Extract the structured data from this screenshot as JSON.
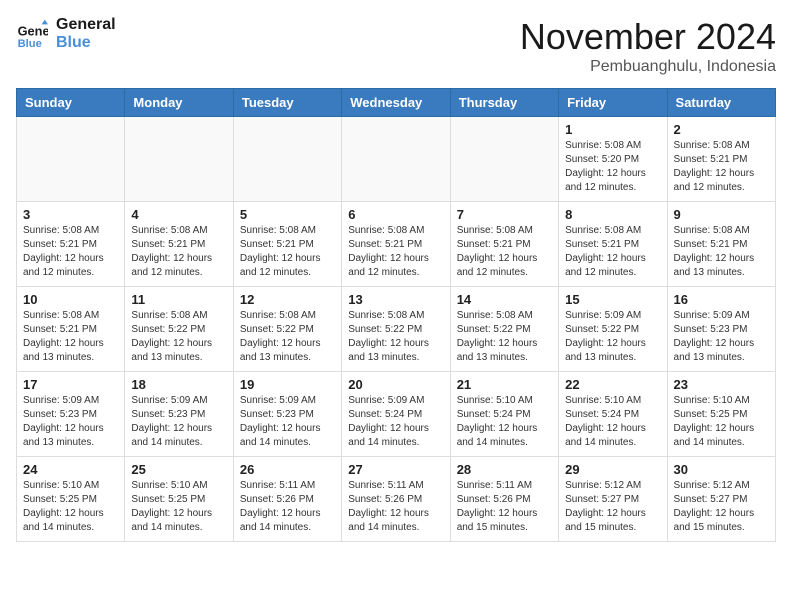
{
  "header": {
    "logo_line1": "General",
    "logo_line2": "Blue",
    "month": "November 2024",
    "location": "Pembuanghulu, Indonesia"
  },
  "days_of_week": [
    "Sunday",
    "Monday",
    "Tuesday",
    "Wednesday",
    "Thursday",
    "Friday",
    "Saturday"
  ],
  "weeks": [
    [
      {
        "day": "",
        "info": ""
      },
      {
        "day": "",
        "info": ""
      },
      {
        "day": "",
        "info": ""
      },
      {
        "day": "",
        "info": ""
      },
      {
        "day": "",
        "info": ""
      },
      {
        "day": "1",
        "info": "Sunrise: 5:08 AM\nSunset: 5:20 PM\nDaylight: 12 hours\nand 12 minutes."
      },
      {
        "day": "2",
        "info": "Sunrise: 5:08 AM\nSunset: 5:21 PM\nDaylight: 12 hours\nand 12 minutes."
      }
    ],
    [
      {
        "day": "3",
        "info": "Sunrise: 5:08 AM\nSunset: 5:21 PM\nDaylight: 12 hours\nand 12 minutes."
      },
      {
        "day": "4",
        "info": "Sunrise: 5:08 AM\nSunset: 5:21 PM\nDaylight: 12 hours\nand 12 minutes."
      },
      {
        "day": "5",
        "info": "Sunrise: 5:08 AM\nSunset: 5:21 PM\nDaylight: 12 hours\nand 12 minutes."
      },
      {
        "day": "6",
        "info": "Sunrise: 5:08 AM\nSunset: 5:21 PM\nDaylight: 12 hours\nand 12 minutes."
      },
      {
        "day": "7",
        "info": "Sunrise: 5:08 AM\nSunset: 5:21 PM\nDaylight: 12 hours\nand 12 minutes."
      },
      {
        "day": "8",
        "info": "Sunrise: 5:08 AM\nSunset: 5:21 PM\nDaylight: 12 hours\nand 12 minutes."
      },
      {
        "day": "9",
        "info": "Sunrise: 5:08 AM\nSunset: 5:21 PM\nDaylight: 12 hours\nand 13 minutes."
      }
    ],
    [
      {
        "day": "10",
        "info": "Sunrise: 5:08 AM\nSunset: 5:21 PM\nDaylight: 12 hours\nand 13 minutes."
      },
      {
        "day": "11",
        "info": "Sunrise: 5:08 AM\nSunset: 5:22 PM\nDaylight: 12 hours\nand 13 minutes."
      },
      {
        "day": "12",
        "info": "Sunrise: 5:08 AM\nSunset: 5:22 PM\nDaylight: 12 hours\nand 13 minutes."
      },
      {
        "day": "13",
        "info": "Sunrise: 5:08 AM\nSunset: 5:22 PM\nDaylight: 12 hours\nand 13 minutes."
      },
      {
        "day": "14",
        "info": "Sunrise: 5:08 AM\nSunset: 5:22 PM\nDaylight: 12 hours\nand 13 minutes."
      },
      {
        "day": "15",
        "info": "Sunrise: 5:09 AM\nSunset: 5:22 PM\nDaylight: 12 hours\nand 13 minutes."
      },
      {
        "day": "16",
        "info": "Sunrise: 5:09 AM\nSunset: 5:23 PM\nDaylight: 12 hours\nand 13 minutes."
      }
    ],
    [
      {
        "day": "17",
        "info": "Sunrise: 5:09 AM\nSunset: 5:23 PM\nDaylight: 12 hours\nand 13 minutes."
      },
      {
        "day": "18",
        "info": "Sunrise: 5:09 AM\nSunset: 5:23 PM\nDaylight: 12 hours\nand 14 minutes."
      },
      {
        "day": "19",
        "info": "Sunrise: 5:09 AM\nSunset: 5:23 PM\nDaylight: 12 hours\nand 14 minutes."
      },
      {
        "day": "20",
        "info": "Sunrise: 5:09 AM\nSunset: 5:24 PM\nDaylight: 12 hours\nand 14 minutes."
      },
      {
        "day": "21",
        "info": "Sunrise: 5:10 AM\nSunset: 5:24 PM\nDaylight: 12 hours\nand 14 minutes."
      },
      {
        "day": "22",
        "info": "Sunrise: 5:10 AM\nSunset: 5:24 PM\nDaylight: 12 hours\nand 14 minutes."
      },
      {
        "day": "23",
        "info": "Sunrise: 5:10 AM\nSunset: 5:25 PM\nDaylight: 12 hours\nand 14 minutes."
      }
    ],
    [
      {
        "day": "24",
        "info": "Sunrise: 5:10 AM\nSunset: 5:25 PM\nDaylight: 12 hours\nand 14 minutes."
      },
      {
        "day": "25",
        "info": "Sunrise: 5:10 AM\nSunset: 5:25 PM\nDaylight: 12 hours\nand 14 minutes."
      },
      {
        "day": "26",
        "info": "Sunrise: 5:11 AM\nSunset: 5:26 PM\nDaylight: 12 hours\nand 14 minutes."
      },
      {
        "day": "27",
        "info": "Sunrise: 5:11 AM\nSunset: 5:26 PM\nDaylight: 12 hours\nand 14 minutes."
      },
      {
        "day": "28",
        "info": "Sunrise: 5:11 AM\nSunset: 5:26 PM\nDaylight: 12 hours\nand 15 minutes."
      },
      {
        "day": "29",
        "info": "Sunrise: 5:12 AM\nSunset: 5:27 PM\nDaylight: 12 hours\nand 15 minutes."
      },
      {
        "day": "30",
        "info": "Sunrise: 5:12 AM\nSunset: 5:27 PM\nDaylight: 12 hours\nand 15 minutes."
      }
    ]
  ]
}
